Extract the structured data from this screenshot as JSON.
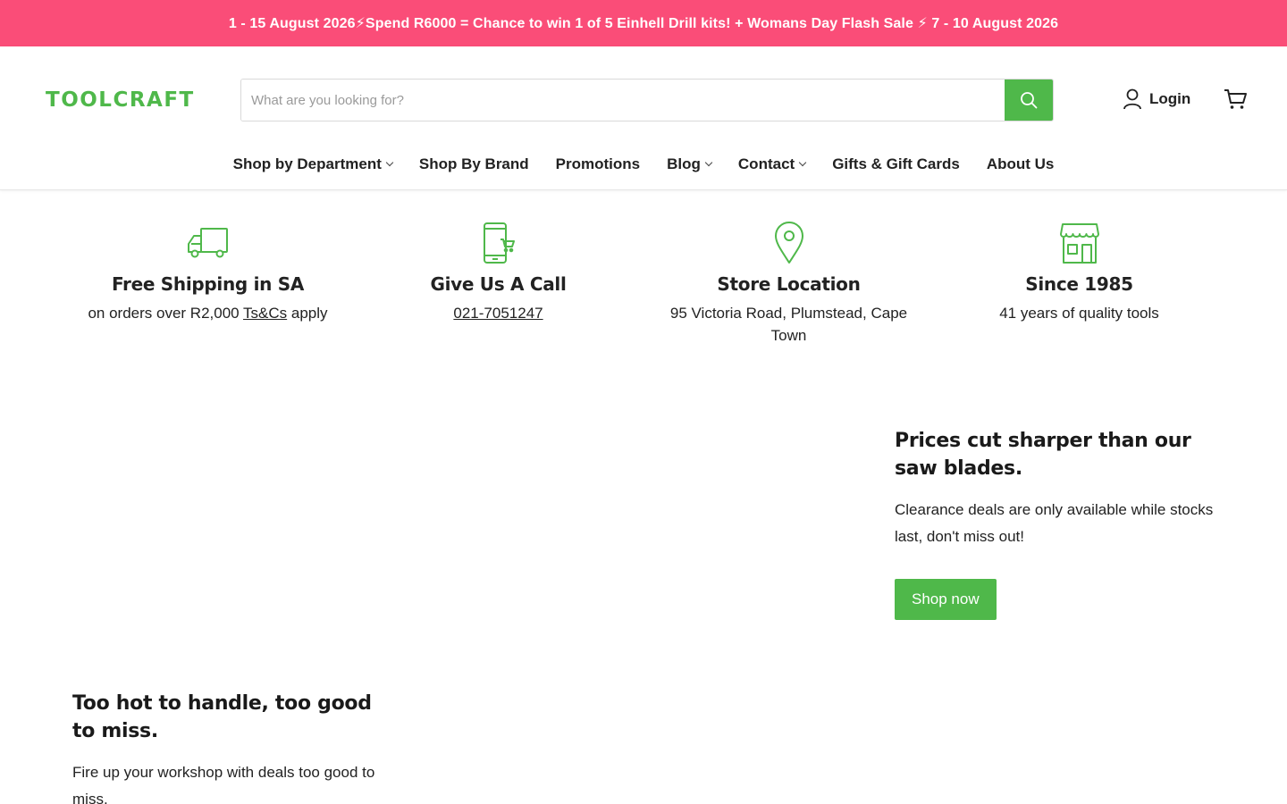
{
  "announcement": {
    "text": "1 - 15 August 2026⚡Spend R6000 = Chance to win 1 of 5 Einhell Drill kits! + Womans Day Flash Sale ⚡ 7 - 10 August 2026",
    "background": "#fa4d78"
  },
  "header": {
    "logo": "TOOLCRAFT",
    "search": {
      "placeholder": "What are you looking for?",
      "value": "",
      "icon": "search-icon"
    },
    "login_label": "Login",
    "cart_icon": "cart-icon"
  },
  "nav": {
    "items": [
      {
        "label": "Shop by Department",
        "dropdown": true
      },
      {
        "label": "Shop By Brand",
        "dropdown": false
      },
      {
        "label": "Promotions",
        "dropdown": false
      },
      {
        "label": "Blog",
        "dropdown": true
      },
      {
        "label": "Contact",
        "dropdown": true
      },
      {
        "label": "Gifts & Gift Cards",
        "dropdown": false
      },
      {
        "label": "About Us",
        "dropdown": false
      }
    ]
  },
  "features": [
    {
      "icon": "truck-icon",
      "title": "Free Shipping in SA",
      "text": "on orders over R2,000 ",
      "link": "Ts&Cs",
      "text_after": " apply"
    },
    {
      "icon": "phone-cart-icon",
      "title": "Give Us A Call",
      "link": " 021-7051247"
    },
    {
      "icon": "map-pin-icon",
      "title": "Store Location",
      "text": "95 Victoria Road, Plumstead, Cape Town"
    },
    {
      "icon": "storefront-icon",
      "title": "Since 1985",
      "text": "41 years of quality tools"
    }
  ],
  "promos": [
    {
      "title": "Prices cut sharper than our saw blades.",
      "text": "Clearance deals are only available while stocks last, don't miss out!",
      "button": "Shop now"
    },
    {
      "title": "Too hot to handle, too good to miss.",
      "text": "Fire up your workshop with deals too good to miss."
    }
  ],
  "colors": {
    "accent": "#4fb84a",
    "banner": "#fa4d78",
    "text": "#222222"
  }
}
